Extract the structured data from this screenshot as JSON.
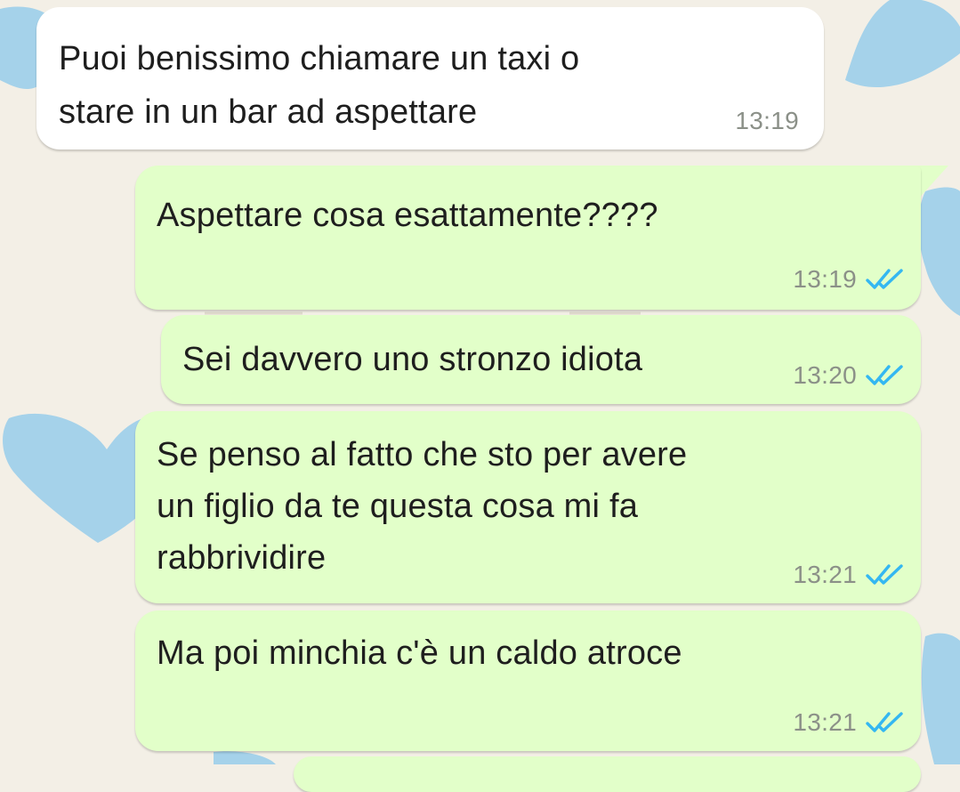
{
  "chat": {
    "theme": {
      "incoming_bubble": "#ffffff",
      "outgoing_bubble": "#e2ffc9",
      "read_tick_color": "#34b7f1",
      "wallpaper_hearts": "#a5d2ea",
      "wallpaper_background": "#f3efe6"
    },
    "messages": [
      {
        "direction": "incoming",
        "text": "Puoi benissimo chiamare un taxi o\nstare in un bar ad aspettare",
        "time": "13:19"
      },
      {
        "direction": "outgoing",
        "text": "Aspettare cosa esattamente????",
        "time": "13:19",
        "status": "read",
        "status_icon": "double-check-icon"
      },
      {
        "direction": "outgoing",
        "text": "Sei davvero uno stronzo idiota",
        "time": "13:20",
        "status": "read",
        "status_icon": "double-check-icon"
      },
      {
        "direction": "outgoing",
        "text": "Se penso al fatto che sto per avere\nun figlio da te questa cosa mi fa\nrabbrividire",
        "time": "13:21",
        "status": "read",
        "status_icon": "double-check-icon"
      },
      {
        "direction": "outgoing",
        "text": "Ma poi minchia c'è un caldo atroce",
        "time": "13:21",
        "status": "read",
        "status_icon": "double-check-icon"
      }
    ]
  }
}
